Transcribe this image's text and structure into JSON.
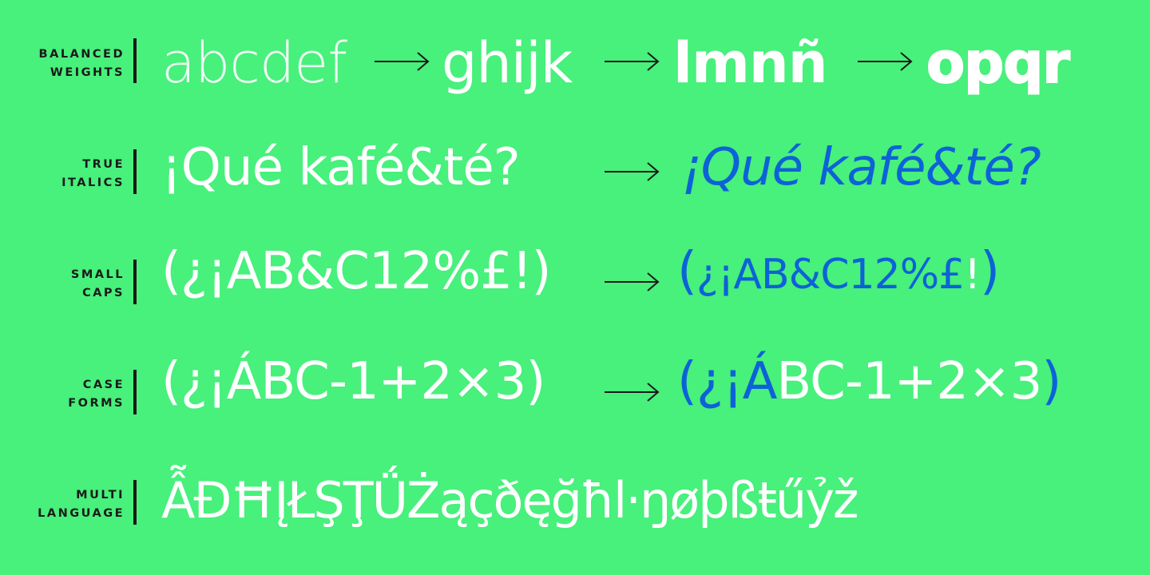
{
  "rows": [
    {
      "label_line1": "BALANCED",
      "label_line2": "WEIGHTS",
      "seg1": "abcdef",
      "seg2": "ghijk",
      "seg3": "lmnñ",
      "seg4": "opqr"
    },
    {
      "label_line1": "TRUE",
      "label_line2": "ITALICS",
      "left": "¡Qué kafé&té?",
      "right": "¡Qué kafé&té?"
    },
    {
      "label_line1": "SMALL",
      "label_line2": "CAPS",
      "left": "(¿¡AB&C12%£!)",
      "right_paren_open": "(",
      "right_body": "¿¡AB&C",
      "right_digits": "12%£",
      "right_tail": "!",
      "right_paren_close": ")"
    },
    {
      "label_line1": "CASE",
      "label_line2": "FORMS",
      "left": "(¿¡ÁBC-1+2×3)",
      "right_paren_open": "(",
      "right_body": "¿¡Á",
      "right_rest": "BC-1+2×3",
      "right_paren_close": ")"
    },
    {
      "label_line1": "MULTI",
      "label_line2": "LANGUAGE",
      "text": "ẪĐĦĮŁŞŢǗŻąçðęğħl·ŋøþßŧűỷž"
    }
  ],
  "colors": {
    "background": "#48f07c",
    "text": "#ffffff",
    "accent": "#0d62d7",
    "label": "#1a1a1a"
  },
  "icons": [
    "arrow-right-icon"
  ]
}
